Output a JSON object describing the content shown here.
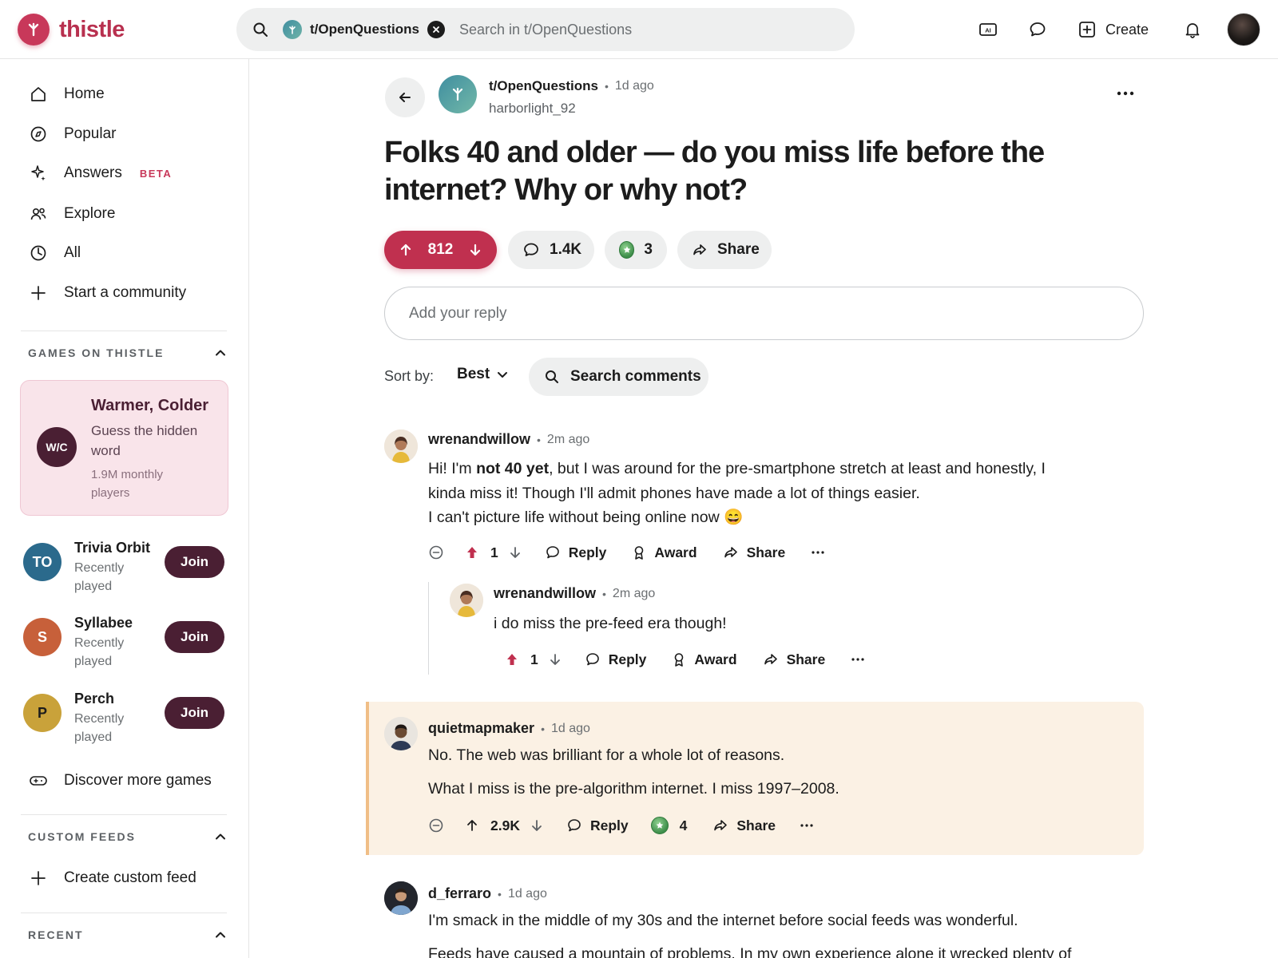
{
  "header": {
    "logo_text": "thistle",
    "search_chip_label": "t/OpenQuestions",
    "search_placeholder": "Search in t/OpenQuestions",
    "create_label": "Create"
  },
  "sidebar": {
    "nav": [
      {
        "label": "Home",
        "icon": "home-icon"
      },
      {
        "label": "Popular",
        "icon": "compass-icon"
      },
      {
        "label": "Answers",
        "icon": "sparkle-icon",
        "badge": "BETA"
      },
      {
        "label": "Explore",
        "icon": "people-icon"
      },
      {
        "label": "All",
        "icon": "chart-icon"
      },
      {
        "label": "Start a community",
        "icon": "plus-icon"
      }
    ],
    "games_heading": "GAMES ON THISTLE",
    "featured_game": {
      "avatar": "W/C",
      "title": "Warmer, Colder",
      "subtitle": "Guess the hidden word",
      "meta": "1.9M monthly players"
    },
    "games": [
      {
        "initials": "TO",
        "name": "Trivia Orbit",
        "meta": "Recently played",
        "join": "Join",
        "color": "#2b6a8c"
      },
      {
        "initials": "S",
        "name": "Syllabee",
        "meta": "Recently played",
        "join": "Join",
        "color": "#c7603a"
      },
      {
        "initials": "P",
        "name": "Perch",
        "meta": "Recently played",
        "join": "Join",
        "color": "#c9a23a"
      }
    ],
    "discover_label": "Discover more games",
    "custom_feeds_heading": "CUSTOM FEEDS",
    "create_feed_label": "Create custom feed",
    "recent_heading": "RECENT"
  },
  "post": {
    "subreddit": "t/OpenQuestions",
    "time": "1d ago",
    "author": "harborlight_92",
    "title": "Folks 40 and older — do you miss life before the internet? Why or why not?",
    "votes": "812",
    "comments": "1.4K",
    "awards": "3",
    "share_label": "Share",
    "reply_placeholder": "Add your reply",
    "sort_label": "Sort by:",
    "sort_value": "Best",
    "search_comments_label": "Search comments"
  },
  "comments": [
    {
      "user": "wrenandwillow",
      "time": "2m ago",
      "body_pre": "Hi! I'm ",
      "body_bold": "not 40 yet",
      "body_post": ", but I was around for the pre-smartphone stretch at least and honestly, I kinda miss it! Though I'll admit phones have made a lot of things easier.",
      "body_line2": "I can't picture life without being online now 😄",
      "score": "1",
      "reply": "Reply",
      "award": "Award",
      "share": "Share"
    },
    {
      "user": "wrenandwillow",
      "time": "2m ago",
      "body": "i do miss the pre-feed era though!",
      "score": "1",
      "reply": "Reply",
      "award": "Award",
      "share": "Share"
    },
    {
      "user": "quietmapmaker",
      "time": "1d ago",
      "body_p1": "No. The web was brilliant for a whole lot of reasons.",
      "body_p2": "What I miss is the pre-algorithm internet. I miss 1997–2008.",
      "score": "2.9K",
      "reply": "Reply",
      "awards": "4",
      "share": "Share"
    },
    {
      "user": "d_ferraro",
      "time": "1d ago",
      "body_p1": "I'm smack in the middle of my 30s and the internet before social feeds was wonderful.",
      "body_p2": "Feeds have caused a mountain of problems. In my own experience alone it wrecked plenty of"
    }
  ],
  "colors": {
    "brand": "#c0304f",
    "game_dark": "#4a1f33",
    "highlight_bg": "#fbf1e4",
    "highlight_border": "#f0be86"
  }
}
